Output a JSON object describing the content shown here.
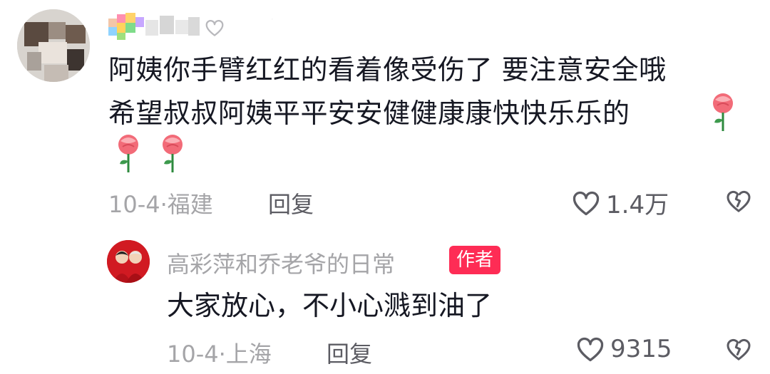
{
  "comment": {
    "line1": "阿姨你手臂红红的看着像受伤了 要注意安全哦",
    "line2": "希望叔叔阿姨平平安安健健康康快快乐乐的",
    "emoji": "rose",
    "date_location": "10-4·福建",
    "reply_label": "回复",
    "like_count": "1.4万",
    "icons": [
      "heart-icon",
      "broken-heart-icon",
      "rose-emoji"
    ]
  },
  "reply": {
    "author_name": "高彩萍和乔老爷的日常",
    "author_badge": "作者",
    "text": "大家放心，不小心溅到油了",
    "date_location": "10-4·上海",
    "reply_label": "回复",
    "like_count": "9315"
  },
  "colors": {
    "text_primary": "#161823",
    "text_secondary": "#a5a5a8",
    "text_action": "#5c5c63",
    "badge_bg": "#fe2c55",
    "background": "#ffffff"
  }
}
